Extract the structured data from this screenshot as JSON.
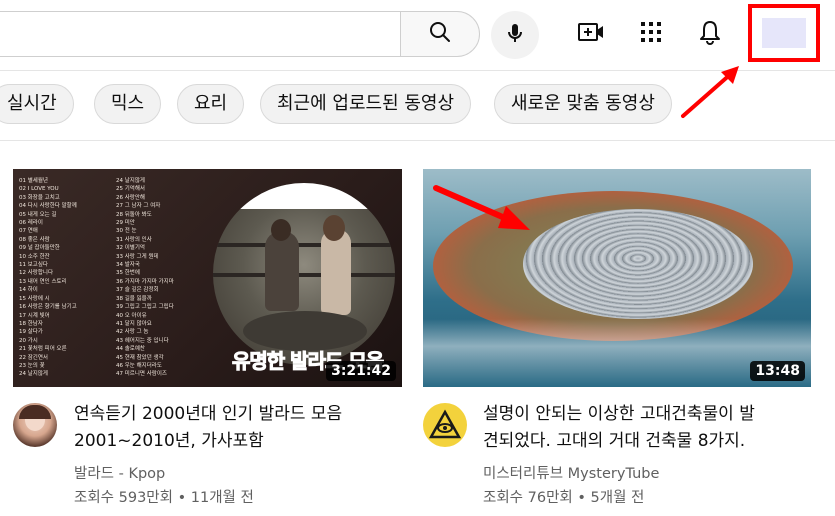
{
  "header": {
    "search_placeholder": "",
    "icons": [
      "search-icon",
      "mic-icon",
      "create-video-icon",
      "apps-grid-icon",
      "notifications-bell-icon",
      "account-avatar"
    ]
  },
  "chips": [
    "실시간",
    "믹스",
    "요리",
    "최근에 업로드된 동영상",
    "새로운 맞춤 동영상"
  ],
  "videos": [
    {
      "duration": "3:21:42",
      "overlay_text": "유명한 발라드 모음",
      "tracklist_left": [
        "01 별세월년",
        "02 I LOVE YOU",
        "03 화장을 고치고",
        "04 다시 사랑한다 말할께",
        "05 내게 오는 길",
        "06 레라이",
        "07 연애",
        "08 좋은 사람",
        "09 널 잡아둘만한",
        "10 소주 한잔",
        "11 보고싶다",
        "12 사랑합니다",
        "13 내어 연인 스토리",
        "14 하이",
        "15 사랑에 시",
        "16 사랑은 향기를 남기고",
        "17 시계 빛어",
        "18 한남자",
        "19 살다가",
        "20 가시",
        "21 꽃처럼 피어 오른",
        "22 잠긴연서",
        "23 눈의 꽃",
        "24 날지않게"
      ],
      "tracklist_right": [
        "24 날지않게",
        "25 기억해서",
        "26 사랑안해",
        "27 그 남자 그 여자",
        "28 뒤돌아 봐도",
        "29 미안",
        "30 전 눈",
        "31 사랑의 인사",
        "32 이별기억",
        "33 사랑 그게 뭔데",
        "34 발자국",
        "35 한번에",
        "36 가지마 가지마 가지마",
        "37 슬 깊은 감정회",
        "38 길을 잃을까",
        "39 그립고 그립고 그립다",
        "40 오 아이유",
        "41 달지 않아요",
        "42 사랑 그 놈",
        "43 헤어지는 중 입니다",
        "44 솔로예찬",
        "45 현재 참았던 생각",
        "46 우눈 해지더라도",
        "47 미르니면 사람이즈"
      ],
      "channel_avatar_icon": "girl-portrait-avatar",
      "title_line1": "연속듣기 2000년대 인기 발라드 모음",
      "title_line2": "2001~2010년, 가사포함",
      "channel": "발라드 - Kpop",
      "stats": "조회수 593만회 • 11개월 전"
    },
    {
      "duration": "13:48",
      "channel_avatar_icon": "eye-pyramid-avatar",
      "title_line1": "설명이 안되는 이상한 고대건축물이 발",
      "title_line2": "견되었다. 고대의 거대 건축물 8가지.",
      "channel": "미스터리튜브 MysteryTube",
      "stats": "조회수 76만회 • 5개월 전"
    }
  ],
  "colors": {
    "annotation": "#ff0000",
    "avatar_fill": "#e6e6fa",
    "chip_bg": "#f2f2f2",
    "meta_text": "#606060"
  }
}
